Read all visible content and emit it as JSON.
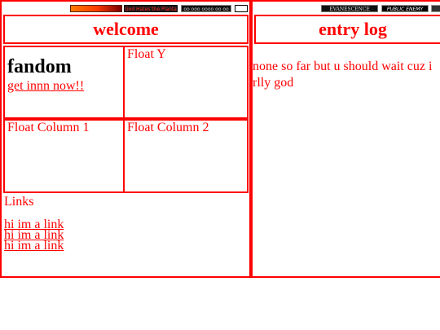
{
  "left_panel": {
    "banners": [
      {
        "label": "",
        "icon": "orange-gradient-banner"
      },
      {
        "label": "God Hates the Plantaris",
        "icon": "dark-red-banner"
      },
      {
        "label": "oo ooo oooo oo oo",
        "icon": "black-banner"
      },
      {
        "label": "",
        "icon": "white-banner"
      }
    ],
    "header": "welcome",
    "fandom": {
      "title": "fandom",
      "link": "get innn now!!"
    },
    "float_y": "Float Y",
    "float_column_1": "Float Column 1",
    "float_column_2": "Float Column 2",
    "links": {
      "heading": "Links",
      "items": [
        "hi im a link",
        "hi im a link",
        "hi im a link"
      ]
    }
  },
  "right_panel": {
    "banners": [
      {
        "label": "EVANESCENCE",
        "icon": "evanescence-banner"
      },
      {
        "label": "PUBLIC ENEMY",
        "icon": "public-banner"
      },
      {
        "label": "",
        "icon": "extra-banner"
      }
    ],
    "header": "entry log",
    "entry_lines": [
      "none so far but u should wait cuz i",
      "rlly god"
    ]
  },
  "colors": {
    "accent": "#ff0000",
    "background": "#ffffff",
    "title_text": "#000000"
  }
}
